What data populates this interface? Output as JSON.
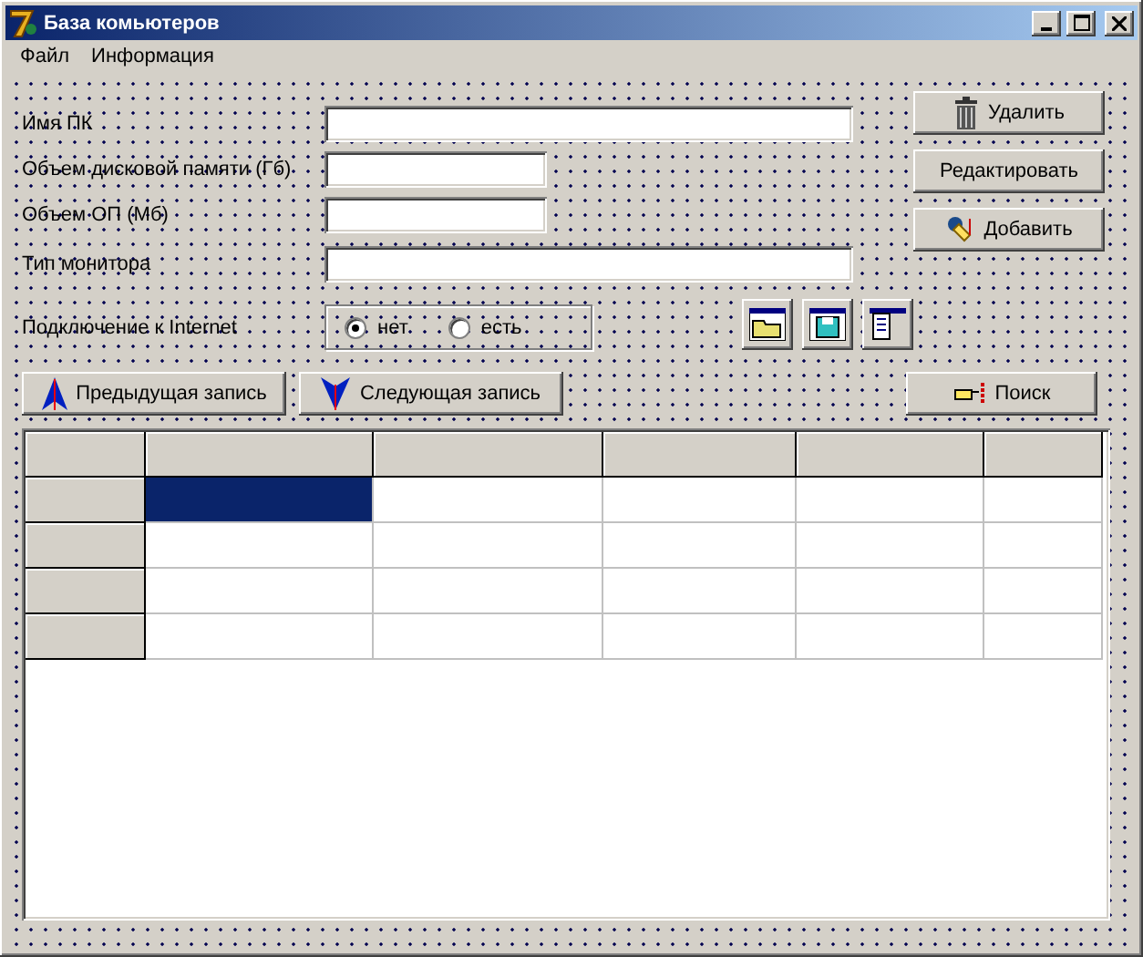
{
  "window": {
    "title": "База комьютеров"
  },
  "menu": [
    {
      "label": "Файл"
    },
    {
      "label": "Информация"
    }
  ],
  "fields": [
    {
      "label": "Имя ПК",
      "kind": "long"
    },
    {
      "label": "Объем дисковой памяти (Гб)",
      "kind": "short"
    },
    {
      "label": "Объем ОП (Мб)",
      "kind": "short"
    },
    {
      "label": "Тип  монитора",
      "kind": "long"
    }
  ],
  "connection": {
    "label": "Подключение к Internet",
    "options": [
      {
        "label": "нет",
        "selected": true
      },
      {
        "label": "есть",
        "selected": false
      }
    ]
  },
  "actions": [
    {
      "label": "Удалить",
      "kind": "trash"
    },
    {
      "label": "Редактировать",
      "kind": "plain"
    },
    {
      "label": "Добавить",
      "kind": "pen"
    }
  ],
  "navigation": [
    {
      "label": "Предыдущая запись",
      "kind": "up"
    },
    {
      "label": "Следующая запись",
      "kind": "down"
    }
  ],
  "search": {
    "label": "Поиск"
  },
  "grid": {
    "rows": [
      {
        "cells": [
          {
            "selected": true
          },
          {
            "selected": false
          },
          {
            "selected": false
          },
          {
            "selected": false
          },
          {
            "selected": false
          }
        ]
      },
      {
        "cells": [
          {
            "selected": false
          },
          {
            "selected": false
          },
          {
            "selected": false
          },
          {
            "selected": false
          },
          {
            "selected": false
          }
        ]
      },
      {
        "cells": [
          {
            "selected": false
          },
          {
            "selected": false
          },
          {
            "selected": false
          },
          {
            "selected": false
          },
          {
            "selected": false
          }
        ]
      },
      {
        "cells": [
          {
            "selected": false
          },
          {
            "selected": false
          },
          {
            "selected": false
          },
          {
            "selected": false
          },
          {
            "selected": false
          }
        ]
      }
    ]
  }
}
